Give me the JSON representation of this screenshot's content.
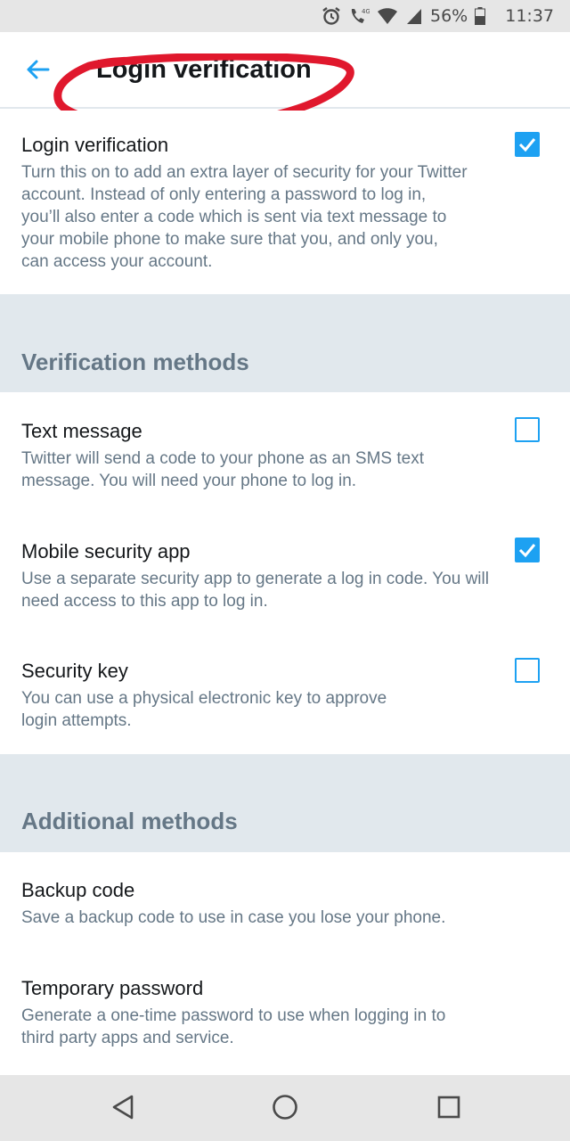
{
  "status_bar": {
    "icons": [
      "alarm-icon",
      "call-4g-icon",
      "wifi-icon",
      "signal-icon",
      "battery-icon"
    ],
    "battery": "56%",
    "time": "11:37"
  },
  "header": {
    "back_icon": "arrow-left-icon",
    "title": "Login verification",
    "annotation_color": "#e0182d"
  },
  "main_setting": {
    "title": "Login verification",
    "description_lines": [
      "Turn this on to add an extra layer of security for your Twitter",
      "account. Instead of only entering a password to log in,",
      "you’ll also enter a code which is sent via text message to",
      "your mobile phone to make sure that you, and only you,",
      "can access your account."
    ],
    "checked": true
  },
  "sections": {
    "verification": {
      "label": "Verification methods",
      "items": [
        {
          "title": "Text message",
          "description_lines": [
            "Twitter will send a code to your phone as an SMS text",
            "message. You will need your phone to log in."
          ],
          "checked": false
        },
        {
          "title": "Mobile security app",
          "description_lines": [
            "Use a separate security app to generate a log in code. You will",
            "need access to this app to log in."
          ],
          "checked": true
        },
        {
          "title": "Security key",
          "description_lines": [
            "You can use a physical electronic key to approve",
            "login attempts."
          ],
          "checked": false
        }
      ]
    },
    "additional": {
      "label": "Additional methods",
      "items": [
        {
          "title": "Backup code",
          "description_lines": [
            "Save a backup code to use in case you lose your phone."
          ]
        },
        {
          "title": "Temporary password",
          "description_lines": [
            "Generate a one-time password to use when logging in to",
            "third party apps and service."
          ]
        }
      ]
    }
  },
  "nav_bar": {
    "buttons": [
      "back-triangle-icon",
      "home-circle-icon",
      "recents-square-icon"
    ]
  },
  "colors": {
    "accent": "#1da1f2",
    "section_band": "#e1e8ed",
    "secondary_text": "#657786"
  }
}
